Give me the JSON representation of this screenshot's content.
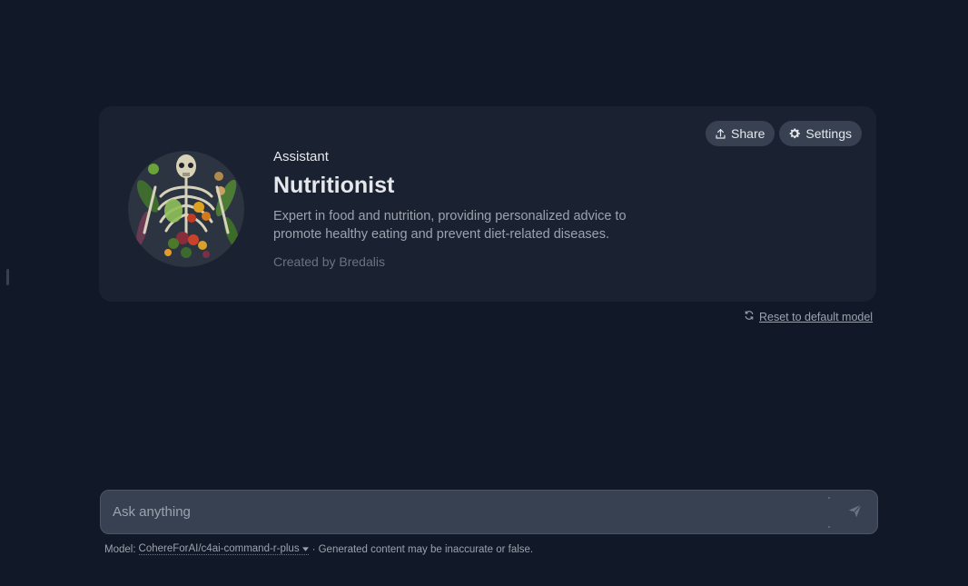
{
  "assistant": {
    "label": "Assistant",
    "name": "Nutritionist",
    "description": "Expert in food and nutrition, providing personalized advice to promote healthy eating and prevent diet-related diseases.",
    "created_prefix": "Created by",
    "creator": "Bredalis",
    "avatar_icon": "nutritionist-avatar"
  },
  "actions": {
    "share_label": "Share",
    "share_icon": "upload-icon",
    "settings_label": "Settings",
    "settings_icon": "gear-icon"
  },
  "reset": {
    "label": "Reset to default model",
    "icon": "refresh-icon"
  },
  "chat_input": {
    "placeholder": "Ask anything",
    "value": "",
    "send_icon": "send-icon"
  },
  "footer": {
    "model_prefix": "Model:",
    "model_name": "CohereForAI/c4ai-command-r-plus",
    "disclaimer": "· Generated content may be inaccurate or false."
  },
  "colors": {
    "background": "#111827",
    "card": "#1a2231",
    "pill": "#374151",
    "input": "#374151"
  }
}
